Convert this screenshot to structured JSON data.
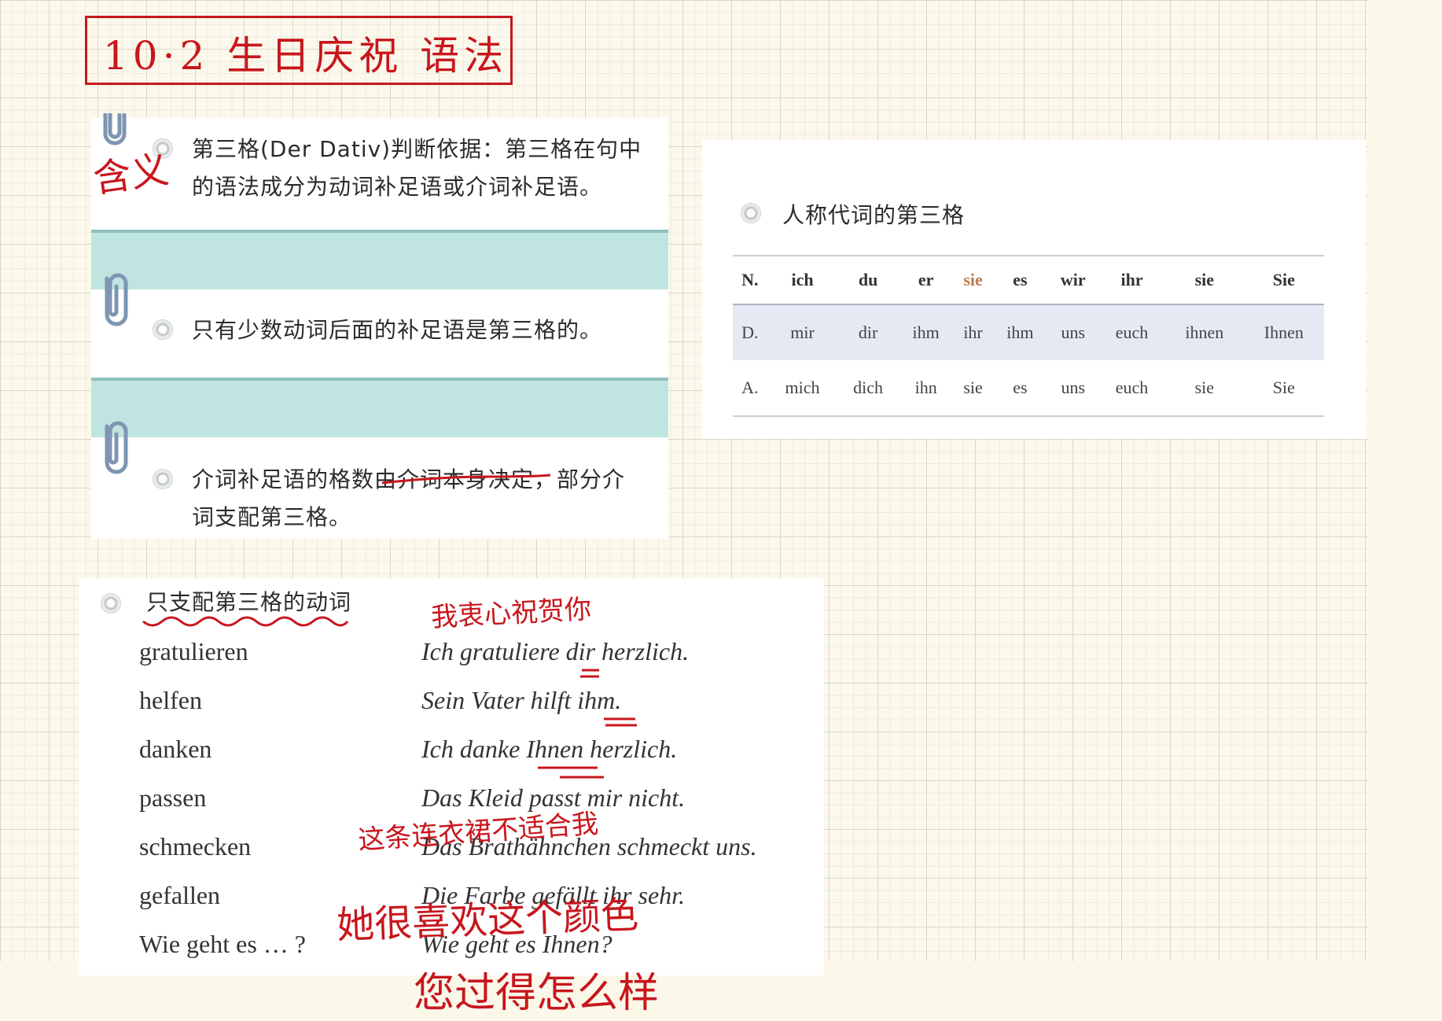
{
  "title_box": {
    "text": "10·2 生日庆祝 语法"
  },
  "margin_note": {
    "text": "含义"
  },
  "left_panel": {
    "items": [
      {
        "line1": "第三格(Der Dativ)判断依据：第三格在句中",
        "line2": "的语法成分为动词补足语或介词补足语。"
      },
      {
        "line1": "只有少数动词后面的补足语是第三格的。",
        "line2": ""
      },
      {
        "line1": "介词补足语的格数由介词本身决定，部分介",
        "line2": "词支配第三格。"
      }
    ]
  },
  "pronoun_panel": {
    "heading": "人称代词的第三格",
    "columns": [
      "N.",
      "ich",
      "du",
      "er",
      "sie",
      "es",
      "wir",
      "ihr",
      "sie",
      "Sie"
    ],
    "rows": [
      [
        "D.",
        "mir",
        "dir",
        "ihm",
        "ihr",
        "ihm",
        "uns",
        "euch",
        "ihnen",
        "Ihnen"
      ],
      [
        "A.",
        "mich",
        "dich",
        "ihn",
        "sie",
        "es",
        "uns",
        "euch",
        "sie",
        "Sie"
      ]
    ],
    "highlight_color": "#c27a4c"
  },
  "verb_panel": {
    "heading": "只支配第三格的动词",
    "verbs": [
      "gratulieren",
      "helfen",
      "danken",
      "passen",
      "schmecken",
      "gefallen",
      "Wie geht es … ?"
    ],
    "examples": [
      "Ich gratuliere dir herzlich.",
      "Sein Vater hilft ihm.",
      "Ich danke Ihnen herzlich.",
      "Das Kleid passt mir nicht.",
      "Das Brathähnchen schmeckt uns.",
      "Die Farbe gefällt ihr sehr.",
      "Wie geht es Ihnen?"
    ]
  },
  "handwriting": {
    "note_gratulieren": "我衷心祝贺你",
    "note_passen": "这条连衣裙不适合我",
    "note_gefallen": "她很喜欢这个颜色",
    "note_wie_geht": "您过得怎么样",
    "ink_color": "#c8161d"
  }
}
